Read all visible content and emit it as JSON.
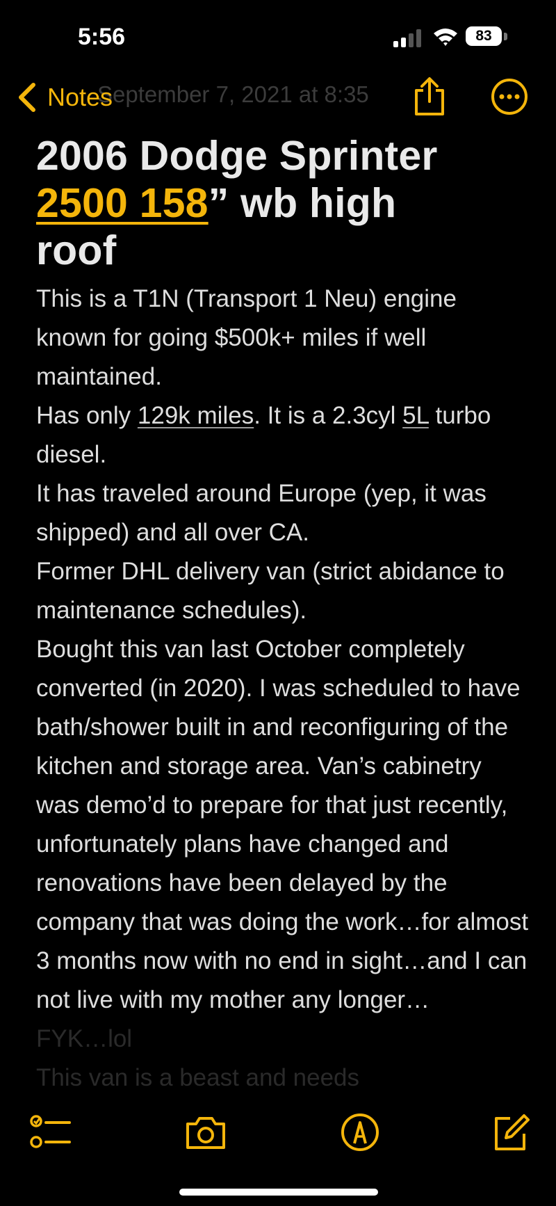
{
  "status_bar": {
    "time": "5:56",
    "battery_level": "83"
  },
  "nav": {
    "back_label": "Notes",
    "date_text": "September 7, 2021 at 8:35",
    "accent_color": "#f4b50b"
  },
  "note": {
    "title_line1": "2006 Dodge Sprinter",
    "title_link": "2500 158",
    "title_after_link": "” wb high",
    "title_line3": "roof",
    "body": {
      "p1": "This is a T1N (Transport 1 Neu) engine known for going $500k+ miles if well maintained.",
      "p2_start": "Has only ",
      "p2_link_miles": "129k miles",
      "p2_mid": ".  It is a 2.3cyl ",
      "p2_link_engine": "5L",
      "p2_end": " turbo diesel.",
      "p3": "It has traveled around Europe (yep, it was shipped) and all over CA.",
      "p4": "Former DHL delivery van (strict abidance to maintenance schedules).",
      "p5": "Bought this van last October completely converted (in 2020). I was scheduled to have bath/shower built in and reconfiguring of the kitchen and storage area. Van’s cabinetry was demo’d to prepare for that just recently, unfortunately  plans  have changed and renovations have been delayed by the company that was doing the work…for almost 3 months now  with no end in sight…and I can not live with my mother any longer…",
      "p6": "FYK…lol",
      "p7": "This van is a beast and needs"
    }
  },
  "toolbar": {
    "checklist_icon": "checklist-icon",
    "camera_icon": "camera-icon",
    "markup_icon": "pen-circle-icon",
    "compose_icon": "compose-icon"
  }
}
